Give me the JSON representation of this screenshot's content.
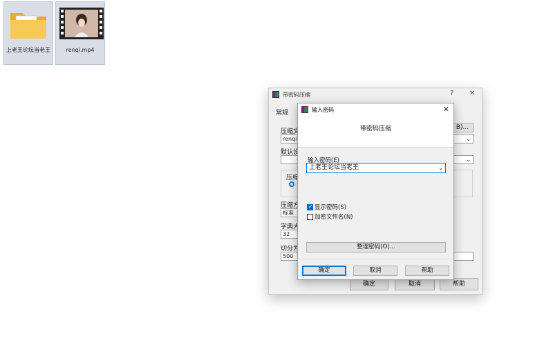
{
  "desktop": {
    "icons": [
      {
        "label": "上老王论坛当老王",
        "icon": "folder-icon"
      },
      {
        "label": "renqi.mp4",
        "icon": "video-file-icon"
      }
    ]
  },
  "back_dialog": {
    "title": "带密码压缩",
    "help_glyph": "?",
    "close_glyph": "✕",
    "tab": "常规",
    "archive_name_label": "压缩文",
    "archive_name_value": "renqi",
    "browse_button_partial": "B)...",
    "default_label": "默认设",
    "format_label": "压缩",
    "method_label": "压缩方",
    "method_value": "标准",
    "dict_label": "字典大",
    "dict_value": "32",
    "split_label": "切分为",
    "split_value": "500",
    "ok": "确定",
    "cancel": "取消",
    "help": "帮助"
  },
  "password_dialog": {
    "title": "输入密码",
    "close_glyph": "✕",
    "header": "带密码压缩",
    "password_label": "输入密码(E)",
    "password_value": "上老王论坛当老王",
    "show_password": {
      "label": "显示密码(S)",
      "checked": true
    },
    "encrypt_names": {
      "label": "加密文件名(N)",
      "checked": false
    },
    "organize_button": "整理密码(O)...",
    "ok": "确定",
    "cancel": "取消",
    "help": "帮助"
  },
  "colors": {
    "accent": "#0078d7",
    "folder": "#f5c04a"
  }
}
